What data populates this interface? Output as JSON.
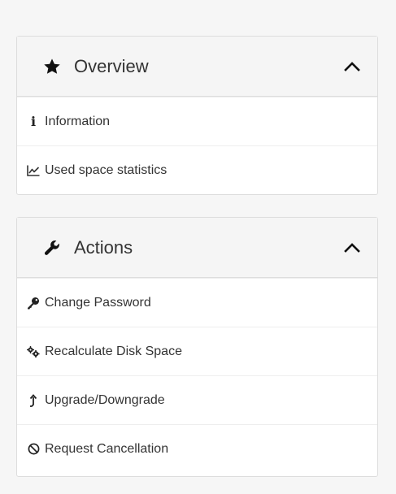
{
  "overview": {
    "title": "Overview",
    "icon": "star-icon",
    "collapse_icon": "chevron-up-icon",
    "items": [
      {
        "label": "Information",
        "icon": "info-icon"
      },
      {
        "label": "Used space statistics",
        "icon": "line-chart-icon"
      }
    ]
  },
  "actions": {
    "title": "Actions",
    "icon": "wrench-icon",
    "collapse_icon": "chevron-up-icon",
    "items": [
      {
        "label": "Change Password",
        "icon": "key-icon"
      },
      {
        "label": "Recalculate Disk Space",
        "icon": "cogs-icon"
      },
      {
        "label": "Upgrade/Downgrade",
        "icon": "level-up-icon"
      },
      {
        "label": "Request Cancellation",
        "icon": "ban-icon"
      }
    ]
  }
}
